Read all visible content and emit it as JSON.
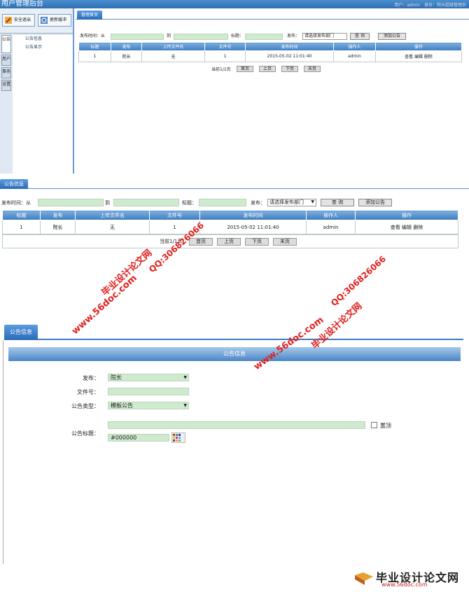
{
  "header": {
    "title": "用户管理后台",
    "user_info": "用户：admin　身份：院长超级管理员"
  },
  "left_buttons": [
    {
      "label": "安全退出"
    },
    {
      "label": "更新缓冲"
    }
  ],
  "vtabs": [
    "公告",
    "用户",
    "事务",
    "设置"
  ],
  "left_menu": [
    "公告信息",
    "公告显示"
  ],
  "tab1": "管理首页",
  "tab2": "公告信息",
  "query": {
    "from_label": "发布时间：从",
    "to_label": "到",
    "title_label": "标题：",
    "dept_label": "发布：",
    "dept_value": "请选择发布部门",
    "search_btn": "查 询",
    "add_btn": "添加公告"
  },
  "table": {
    "headers": [
      "标题",
      "发布",
      "上传文件名",
      "文件号",
      "发布时间",
      "操作人",
      "操作"
    ],
    "rows": [
      [
        "1",
        "院长",
        "无",
        "1",
        "2015-05-02 11:01:40",
        "admin",
        "查看 编辑 删除"
      ]
    ]
  },
  "pager": {
    "info": "当前1/1页",
    "first": "首页",
    "prev": "上页",
    "next": "下页",
    "last": "末页"
  },
  "form": {
    "section_title": "公告信息",
    "publish_label": "发布：",
    "publish_value": "院长",
    "fileno_label": "文件号：",
    "type_label": "公告类型：",
    "type_value": "模板公告",
    "title_label": "公告标题：",
    "top_label": "置顶",
    "color_value": "#000000"
  },
  "watermarks": [
    "毕业设计论文网",
    "QQ:306826066",
    "www.56doc.com"
  ],
  "logo": {
    "brand": "毕业设计论文网",
    "url": "www.56doc.com"
  },
  "colors": {
    "accent": "#3d7cc0",
    "input": "#cfeacf",
    "watermark": "#e02020"
  }
}
